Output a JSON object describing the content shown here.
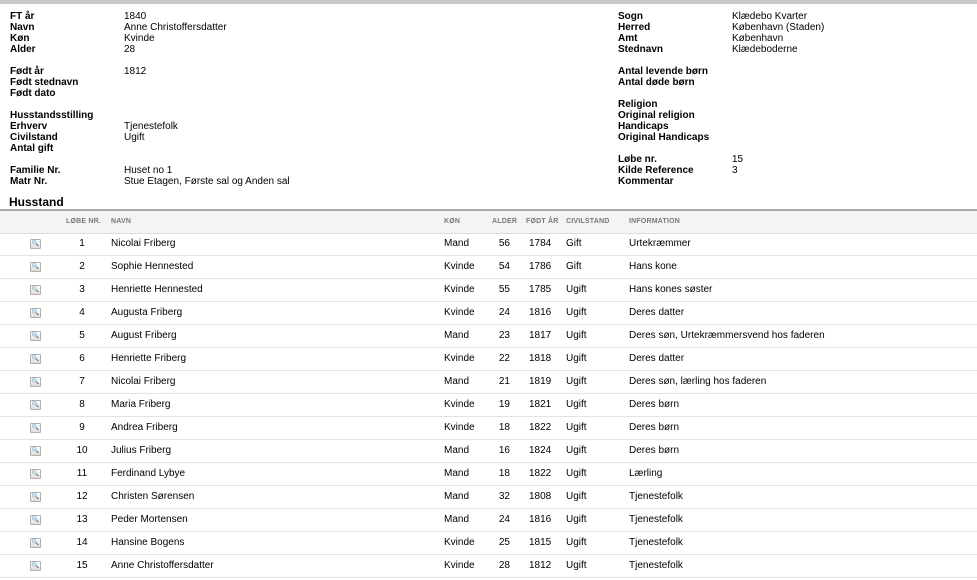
{
  "person": {
    "left": [
      {
        "label": "FT år",
        "value": "1840"
      },
      {
        "label": "Navn",
        "value": "Anne Christoffersdatter"
      },
      {
        "label": "Køn",
        "value": "Kvinde"
      },
      {
        "label": "Alder",
        "value": "28"
      },
      {
        "label": "Født år",
        "value": "1812"
      },
      {
        "label": "Født stednavn",
        "value": ""
      },
      {
        "label": "Født dato",
        "value": ""
      },
      {
        "label": "Husstandsstilling",
        "value": ""
      },
      {
        "label": "Erhverv",
        "value": "Tjenestefolk"
      },
      {
        "label": "Civilstand",
        "value": "Ugift"
      },
      {
        "label": "Antal gift",
        "value": ""
      },
      {
        "label": "Familie Nr.",
        "value": "Huset no 1"
      },
      {
        "label": "Matr Nr.",
        "value": "Stue Etagen, Første sal og Anden sal"
      }
    ],
    "right": [
      {
        "label": "Sogn",
        "value": "Klædebo Kvarter"
      },
      {
        "label": "Herred",
        "value": "København (Staden)"
      },
      {
        "label": "Amt",
        "value": "København"
      },
      {
        "label": "Stednavn",
        "value": "Klædeboderne"
      },
      {
        "label": "Antal levende børn",
        "value": ""
      },
      {
        "label": "Antal døde børn",
        "value": ""
      },
      {
        "label": "Religion",
        "value": ""
      },
      {
        "label": "Original religion",
        "value": ""
      },
      {
        "label": "Handicaps",
        "value": ""
      },
      {
        "label": "Original Handicaps",
        "value": ""
      },
      {
        "label": "Løbe nr.",
        "value": "15"
      },
      {
        "label": "Kilde Reference",
        "value": "3"
      },
      {
        "label": "Kommentar",
        "value": ""
      }
    ]
  },
  "household": {
    "title": "Husstand",
    "columns": {
      "nr": "LØBE NR.",
      "navn": "NAVN",
      "kon": "KØN",
      "alder": "ALDER",
      "fodt": "FØDT ÅR",
      "civil": "CIVILSTAND",
      "info": "INFORMATION"
    },
    "rows": [
      {
        "nr": "1",
        "navn": "Nicolai Friberg",
        "kon": "Mand",
        "alder": "56",
        "fodt": "1784",
        "civil": "Gift",
        "info": "Urtekræmmer"
      },
      {
        "nr": "2",
        "navn": "Sophie Hennested",
        "kon": "Kvinde",
        "alder": "54",
        "fodt": "1786",
        "civil": "Gift",
        "info": "Hans kone"
      },
      {
        "nr": "3",
        "navn": "Henriette Hennested",
        "kon": "Kvinde",
        "alder": "55",
        "fodt": "1785",
        "civil": "Ugift",
        "info": "Hans kones søster"
      },
      {
        "nr": "4",
        "navn": "Augusta Friberg",
        "kon": "Kvinde",
        "alder": "24",
        "fodt": "1816",
        "civil": "Ugift",
        "info": "Deres datter"
      },
      {
        "nr": "5",
        "navn": "August Friberg",
        "kon": "Mand",
        "alder": "23",
        "fodt": "1817",
        "civil": "Ugift",
        "info": "Deres søn, Urtekræmmersvend hos faderen"
      },
      {
        "nr": "6",
        "navn": "Henriette Friberg",
        "kon": "Kvinde",
        "alder": "22",
        "fodt": "1818",
        "civil": "Ugift",
        "info": "Deres datter"
      },
      {
        "nr": "7",
        "navn": "Nicolai Friberg",
        "kon": "Mand",
        "alder": "21",
        "fodt": "1819",
        "civil": "Ugift",
        "info": "Deres søn, lærling hos faderen"
      },
      {
        "nr": "8",
        "navn": "Maria Friberg",
        "kon": "Kvinde",
        "alder": "19",
        "fodt": "1821",
        "civil": "Ugift",
        "info": "Deres børn"
      },
      {
        "nr": "9",
        "navn": "Andrea Friberg",
        "kon": "Kvinde",
        "alder": "18",
        "fodt": "1822",
        "civil": "Ugift",
        "info": "Deres børn"
      },
      {
        "nr": "10",
        "navn": "Julius Friberg",
        "kon": "Mand",
        "alder": "16",
        "fodt": "1824",
        "civil": "Ugift",
        "info": "Deres børn"
      },
      {
        "nr": "11",
        "navn": "Ferdinand Lybye",
        "kon": "Mand",
        "alder": "18",
        "fodt": "1822",
        "civil": "Ugift",
        "info": "Lærling"
      },
      {
        "nr": "12",
        "navn": "Christen Sørensen",
        "kon": "Mand",
        "alder": "32",
        "fodt": "1808",
        "civil": "Ugift",
        "info": "Tjenestefolk"
      },
      {
        "nr": "13",
        "navn": "Peder Mortensen",
        "kon": "Mand",
        "alder": "24",
        "fodt": "1816",
        "civil": "Ugift",
        "info": "Tjenestefolk"
      },
      {
        "nr": "14",
        "navn": "Hansine Bogens",
        "kon": "Kvinde",
        "alder": "25",
        "fodt": "1815",
        "civil": "Ugift",
        "info": "Tjenestefolk"
      },
      {
        "nr": "15",
        "navn": "Anne Christoffersdatter",
        "kon": "Kvinde",
        "alder": "28",
        "fodt": "1812",
        "civil": "Ugift",
        "info": "Tjenestefolk"
      }
    ],
    "view_icon": "magnifier-icon"
  }
}
